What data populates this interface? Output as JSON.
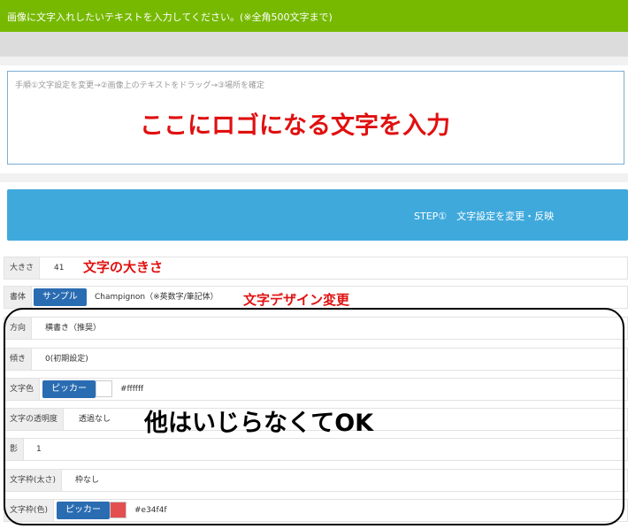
{
  "header": {
    "text": "画像に文字入れしたいテキストを入力してください。(※全角500文字まで)"
  },
  "textarea": {
    "placeholder": "手順①文字設定を変更→②画像上のテキストをドラッグ→③場所を確定"
  },
  "annotations": {
    "input_here": "ここにロゴになる文字を入力",
    "size": "文字の大きさ",
    "design": "文字デザイン変更",
    "others_ok": "他はいじらなくてOK"
  },
  "step_button": {
    "label": "STEP①　文字設定を変更・反映"
  },
  "settings": {
    "size": {
      "label": "大きさ",
      "value": "41"
    },
    "font": {
      "label": "書体",
      "button": "サンプル",
      "value": "Champignon（※英数字/筆記体）"
    },
    "direction": {
      "label": "方向",
      "value": "横書き（推奨）"
    },
    "tilt": {
      "label": "傾き",
      "value": "0(初期設定)"
    },
    "text_color": {
      "label": "文字色",
      "button": "ピッカー",
      "value": "#ffffff",
      "swatch": "#ffffff"
    },
    "opacity": {
      "label": "文字の透明度",
      "value": "透過なし"
    },
    "shadow": {
      "label": "影",
      "value": "1"
    },
    "stroke_width": {
      "label": "文字枠(太さ)",
      "value": "枠なし"
    },
    "stroke_color": {
      "label": "文字枠(色)",
      "button": "ピッカー",
      "value": "#e34f4f",
      "swatch": "#e34f4f"
    }
  },
  "colors": {
    "header": "#76b900",
    "step_button": "#3fa9dc",
    "picker_button": "#2a6cb1",
    "annotation": "#e01010"
  }
}
